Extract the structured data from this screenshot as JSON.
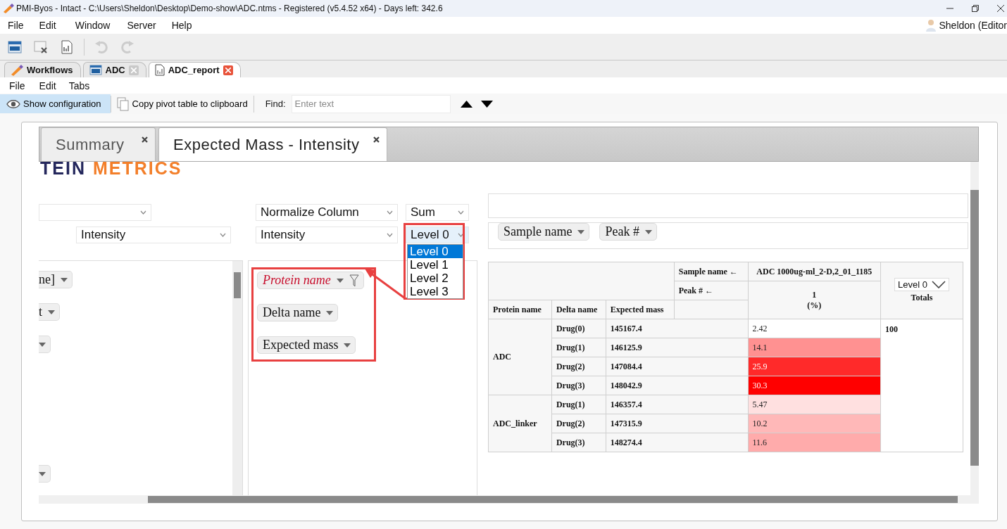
{
  "window": {
    "title": "PMI-Byos - Intact - C:\\Users\\Sheldon\\Desktop\\Demo-show\\ADC.ntms - Registered (v5.4.52 x64) - Days left: 342.6"
  },
  "menu": [
    "File",
    "Edit",
    "Window",
    "Server",
    "Help"
  ],
  "user": "Sheldon (Editor",
  "toolbar": [
    {
      "kind": "open",
      "disabled": false
    },
    {
      "kind": "close",
      "disabled": false
    },
    {
      "kind": "report",
      "disabled": false
    },
    {
      "kind": "undo",
      "disabled": true
    },
    {
      "kind": "redo",
      "disabled": true
    }
  ],
  "doc_tabs": [
    {
      "label": "Workflows",
      "kind": "workflow",
      "selected": false,
      "closable": false
    },
    {
      "label": "ADC",
      "kind": "project",
      "selected": false,
      "closable": true
    },
    {
      "label": "ADC_report",
      "kind": "report",
      "selected": true,
      "closable": true
    }
  ],
  "report_menu": [
    "File",
    "Edit",
    "Tabs"
  ],
  "actions": {
    "show_config": {
      "label": "Show configuration",
      "selected": true
    },
    "copy": {
      "label": "Copy pivot table to clipboard"
    },
    "find": {
      "label": "Find:",
      "placeholder": "Enter text"
    }
  },
  "view_tabs": [
    {
      "label": "Summary",
      "selected": false
    },
    {
      "label": "Expected Mass - Intensity",
      "selected": true
    }
  ],
  "logo": {
    "dark": "TEIN",
    "accent": "METRICS"
  },
  "aggregator": {
    "function": "Normalize Column",
    "sub": "Sum",
    "value_left": "Intensity",
    "value": "Intensity"
  },
  "level_select": {
    "value": "Level 0",
    "expanded": true,
    "options": [
      {
        "label": "Level 0",
        "selected": true
      },
      {
        "label": "Level 1",
        "selected": false
      },
      {
        "label": "Level 2",
        "selected": false
      },
      {
        "label": "Level 3",
        "selected": false
      }
    ]
  },
  "unused_attributes": [
    "ne]",
    "t"
  ],
  "row_attributes": [
    {
      "label": "Protein name",
      "filtered": true
    },
    {
      "label": "Delta name",
      "filtered": false
    },
    {
      "label": "Expected mass",
      "filtered": false
    }
  ],
  "col_attributes": [
    {
      "label": "Sample name",
      "filtered": false
    },
    {
      "label": "Peak #",
      "filtered": false
    }
  ],
  "pivot": {
    "col_headers": [
      "Sample name ←",
      "Peak # ←"
    ],
    "sample": "ADC 1000ug-ml_2-D,2_01_1185",
    "peak": "1\n(%)",
    "totals_select": "Level 0",
    "totals_label": "Totals",
    "row_headers": [
      "Protein name",
      "Delta name",
      "Expected mass"
    ],
    "total": "100",
    "groups": [
      {
        "protein": "ADC",
        "rows": [
          {
            "delta": "Drug(0)",
            "mass": "145167.4",
            "value": "2.42",
            "color": "#ffffff"
          },
          {
            "delta": "Drug(1)",
            "mass": "146125.9",
            "value": "14.1",
            "color": "#ff9191"
          },
          {
            "delta": "Drug(2)",
            "mass": "147084.4",
            "value": "25.9",
            "color": "#ff2a2a"
          },
          {
            "delta": "Drug(3)",
            "mass": "148042.9",
            "value": "30.3",
            "color": "#ff0000"
          }
        ]
      },
      {
        "protein": "ADC_linker",
        "rows": [
          {
            "delta": "Drug(1)",
            "mass": "146357.4",
            "value": "5.47",
            "color": "#ffe0e0"
          },
          {
            "delta": "Drug(2)",
            "mass": "147315.9",
            "value": "10.2",
            "color": "#ffb8b8"
          },
          {
            "delta": "Drug(3)",
            "mass": "148274.4",
            "value": "11.6",
            "color": "#ffabab"
          }
        ]
      }
    ]
  }
}
